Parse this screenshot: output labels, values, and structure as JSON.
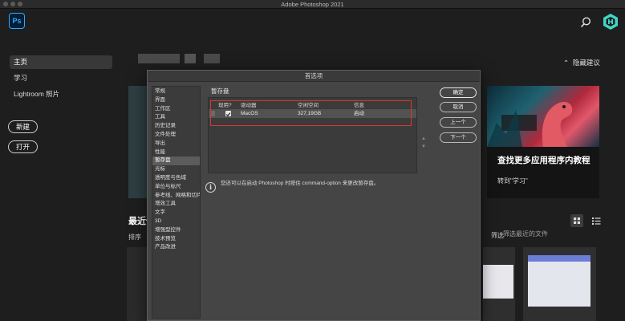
{
  "window": {
    "title": "Adobe Photoshop 2021"
  },
  "app": {
    "logo_text": "Ps"
  },
  "sidebar": {
    "items": [
      {
        "label": "主页"
      },
      {
        "label": "学习"
      },
      {
        "label": "Lightroom 照片"
      }
    ],
    "new_label": "新建",
    "open_label": "打开"
  },
  "home": {
    "hide_suggestions_label": "隐藏建议",
    "promo_title": "查找更多应用程序内教程",
    "promo_link": "转到\"学习\"",
    "recent_heading": "最近使",
    "sort_label": "排序",
    "filter_label": "筛选",
    "filter_placeholder": "筛选最近的文件"
  },
  "dialog": {
    "title": "首选项",
    "categories": [
      "常规",
      "界面",
      "工作区",
      "工具",
      "历史记录",
      "文件处理",
      "导出",
      "性能",
      "暂存盘",
      "光标",
      "透明度与色域",
      "单位与标尺",
      "参考线、网格和切片",
      "增效工具",
      "文字",
      "3D",
      "增强型控件",
      "技术预览",
      "产品改进"
    ],
    "active_category": "暂存盘",
    "section_title": "暂存盘",
    "table": {
      "headers": [
        "现用?",
        "驱动器",
        "空闲空间",
        "信息"
      ],
      "rows": [
        {
          "active": true,
          "drive": "MacOS",
          "free": "327,19GB",
          "info": "启动"
        }
      ]
    },
    "info_text": "您还可以在启动 Photoshop 时按住 command-option 来更改暂存盘。",
    "buttons": {
      "ok": "确定",
      "cancel": "取消",
      "prev": "上一个",
      "next": "下一个"
    }
  },
  "colors": {
    "background": "#1e1e1e",
    "dialog": "#454545",
    "highlight": "#d63a2c",
    "ps_blue": "#31a8ff",
    "avatar": "#3fd6c4"
  },
  "icons": [
    "search-icon",
    "user-avatar-icon",
    "arrow-up-icon",
    "arrow-down-icon",
    "info-icon",
    "grid-view-icon",
    "list-view-icon",
    "chevron-up-icon"
  ]
}
